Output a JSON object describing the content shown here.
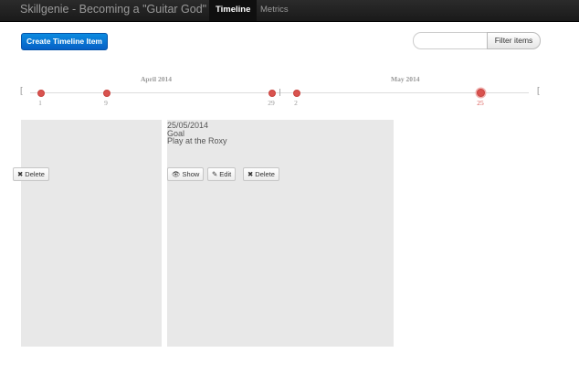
{
  "navbar": {
    "brand": "Skillgenie - Becoming a \"Guitar God\"",
    "tabs": [
      {
        "label": "Timeline",
        "active": true
      },
      {
        "label": "Metrics",
        "active": false
      }
    ]
  },
  "toolbar": {
    "create_label": "Create Timeline Item",
    "filter_value": "",
    "filter_button_label": "Filter items"
  },
  "timeline": {
    "months": [
      "April 2014",
      "May 2014"
    ],
    "start_bracket": "[",
    "end_bracket": "[",
    "dates": [
      "1",
      "9",
      "29",
      "2",
      "25"
    ],
    "selected_date": "25"
  },
  "cards": [
    {
      "buttons": [
        {
          "label": "Delete",
          "icon": "close-icon"
        }
      ]
    },
    {
      "date": "25/05/2014",
      "type": "Goal",
      "title": "Play at the Roxy",
      "buttons": [
        {
          "label": "Show",
          "icon": "eye-icon"
        },
        {
          "label": "Edit",
          "icon": "pencil-icon"
        },
        {
          "label": "Delete",
          "icon": "close-icon"
        }
      ]
    }
  ],
  "colors": {
    "navbar_bg": "#1b1b1b",
    "primary": "#0670d6",
    "timeline_dot": "#d9534f",
    "card_bg": "#e8e8e8"
  }
}
